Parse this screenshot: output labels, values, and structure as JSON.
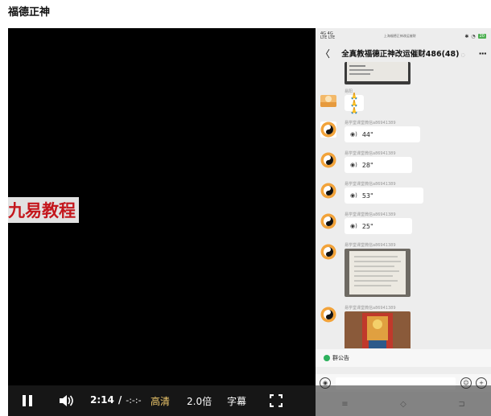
{
  "page": {
    "title": "福德正神"
  },
  "video": {
    "watermark": "九易教程",
    "phone": {
      "status": {
        "left_line1": "4G 4G",
        "left_line2": "LTE LTE",
        "center": "上海福德正神改运催财",
        "battery": "20"
      },
      "chat": {
        "title": "全真教福德正神改运催财486(48)",
        "muted_icon": "bell-off-icon"
      },
      "messages": [
        {
          "type": "image",
          "sender": ""
        },
        {
          "type": "text",
          "sender": "易阳",
          "text": "🙏🙏🙏"
        },
        {
          "type": "voice",
          "sender": "易学堂课堂微信a86941389",
          "duration": "44\""
        },
        {
          "type": "voice",
          "sender": "易学堂课堂微信a86941389",
          "duration": "28\""
        },
        {
          "type": "voice",
          "sender": "易学堂课堂微信a86941389",
          "duration": "53\""
        },
        {
          "type": "voice",
          "sender": "易学堂课堂微信a86941389",
          "duration": "25\""
        },
        {
          "type": "image",
          "sender": "易学堂课堂微信a86941389"
        },
        {
          "type": "image",
          "sender": "易学堂课堂微信a86941389"
        }
      ],
      "notice": "群公告"
    },
    "controls": {
      "current_time": "2:14",
      "separator": "/",
      "duration": "-:-:-",
      "quality": "高清",
      "speed": "2.0倍",
      "subtitle": "字幕"
    }
  },
  "colors": {
    "quality_accent": "#f0c96c",
    "watermark_red": "#c4161c",
    "notice_green": "#2db15d"
  }
}
